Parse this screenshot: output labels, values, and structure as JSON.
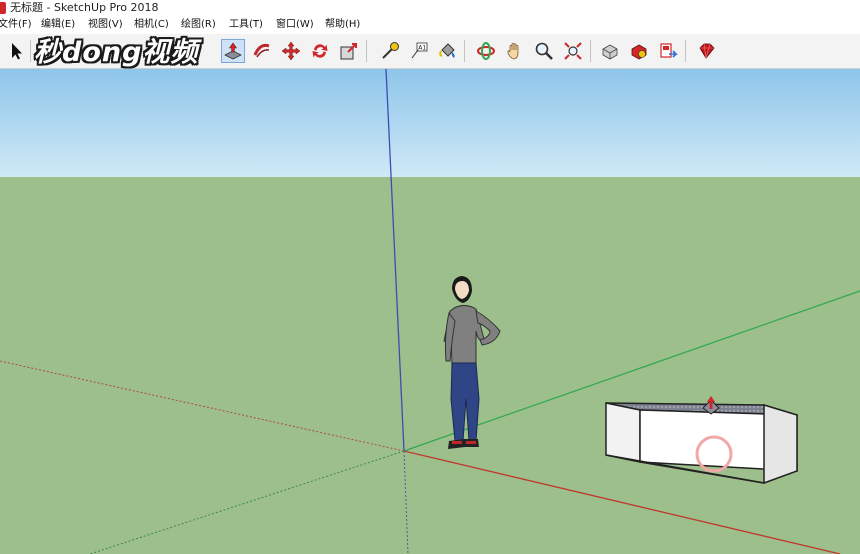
{
  "window": {
    "title": "无标题 - SketchUp Pro 2018"
  },
  "menu": {
    "items": [
      {
        "id": "file",
        "label": "文件(F)"
      },
      {
        "id": "edit",
        "label": "编辑(E)"
      },
      {
        "id": "view",
        "label": "视图(V)"
      },
      {
        "id": "camera",
        "label": "相机(C)"
      },
      {
        "id": "draw",
        "label": "绘图(R)"
      },
      {
        "id": "tools",
        "label": "工具(T)"
      },
      {
        "id": "window",
        "label": "窗口(W)"
      },
      {
        "id": "help",
        "label": "帮助(H)"
      }
    ]
  },
  "watermark": {
    "text": "秒dong视频"
  },
  "toolbar": {
    "icons": [
      "select-arrow-icon",
      "push-pull-icon",
      "follow-me-icon",
      "move-icon",
      "rotate-icon",
      "scale-icon",
      "tape-measure-icon",
      "text-label-icon",
      "paint-bucket-icon",
      "orbit-icon",
      "pan-hand-icon",
      "zoom-icon",
      "zoom-extents-icon",
      "3d-warehouse-icon",
      "extension-warehouse-icon",
      "send-to-layout-icon",
      "ruby-extension-icon"
    ],
    "active_tool": "push-pull-icon"
  },
  "scene": {
    "sky_color": "#a9d4ee",
    "ground_color": "#9cbf8c",
    "axis_red": "#c0392b",
    "axis_green": "#2fa84f",
    "axis_blue": "#3a4fb0",
    "figure": "person-figure",
    "box_top_color": "#8a8e9a",
    "box_side_color": "#ffffff",
    "cursor": "push-pull-cursor"
  }
}
